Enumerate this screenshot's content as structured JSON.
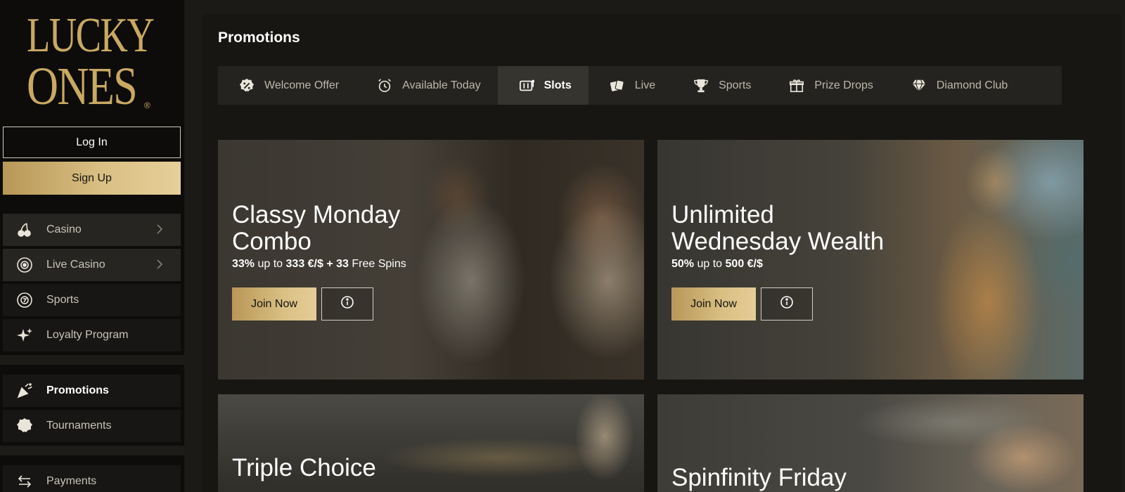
{
  "brand": {
    "logo_line1": "LUCKY",
    "logo_line2": "ONES",
    "logo_mark": "®",
    "gold": "#c9a961"
  },
  "auth": {
    "login_label": "Log In",
    "signup_label": "Sign Up"
  },
  "sidebar": {
    "items": [
      {
        "label": "Casino",
        "icon": "cherries-icon",
        "has_chevron": true
      },
      {
        "label": "Live Casino",
        "icon": "casino-chip-icon",
        "has_chevron": true
      },
      {
        "label": "Sports",
        "icon": "sports-ball-icon",
        "has_chevron": false
      },
      {
        "label": "Loyalty Program",
        "icon": "sparkle-icon",
        "has_chevron": false
      },
      {
        "label": "Promotions",
        "icon": "party-popper-icon",
        "active": true
      },
      {
        "label": "Tournaments",
        "icon": "badge-ribbon-icon"
      },
      {
        "label": "Payments",
        "icon": "arrows-icon"
      }
    ]
  },
  "main": {
    "title": "Promotions",
    "tabs": [
      {
        "label": "Welcome Offer",
        "icon": "percent-badge-icon"
      },
      {
        "label": "Available Today",
        "icon": "alarm-clock-icon"
      },
      {
        "label": "Slots",
        "icon": "slot-machine-icon",
        "active": true
      },
      {
        "label": "Live",
        "icon": "cards-icon"
      },
      {
        "label": "Sports",
        "icon": "trophy-icon"
      },
      {
        "label": "Prize Drops",
        "icon": "gift-icon"
      },
      {
        "label": "Diamond Club",
        "icon": "diamond-icon"
      }
    ],
    "cards": [
      {
        "title_line1": "Classy Monday",
        "title_line2": "Combo",
        "offer_a": "33%",
        "offer_b": " up to ",
        "offer_c": "333 €/$",
        "offer_d": " + 33 ",
        "offer_e": "Free Spins",
        "join_label": "Join Now"
      },
      {
        "title_line1": "Unlimited",
        "title_line2": "Wednesday Wealth",
        "offer_a": "50%",
        "offer_b": " up to ",
        "offer_c": "500 €/$",
        "join_label": "Join Now"
      },
      {
        "title_line1": "Triple Choice"
      },
      {
        "title_line1": "Spinfinity Friday"
      }
    ]
  }
}
